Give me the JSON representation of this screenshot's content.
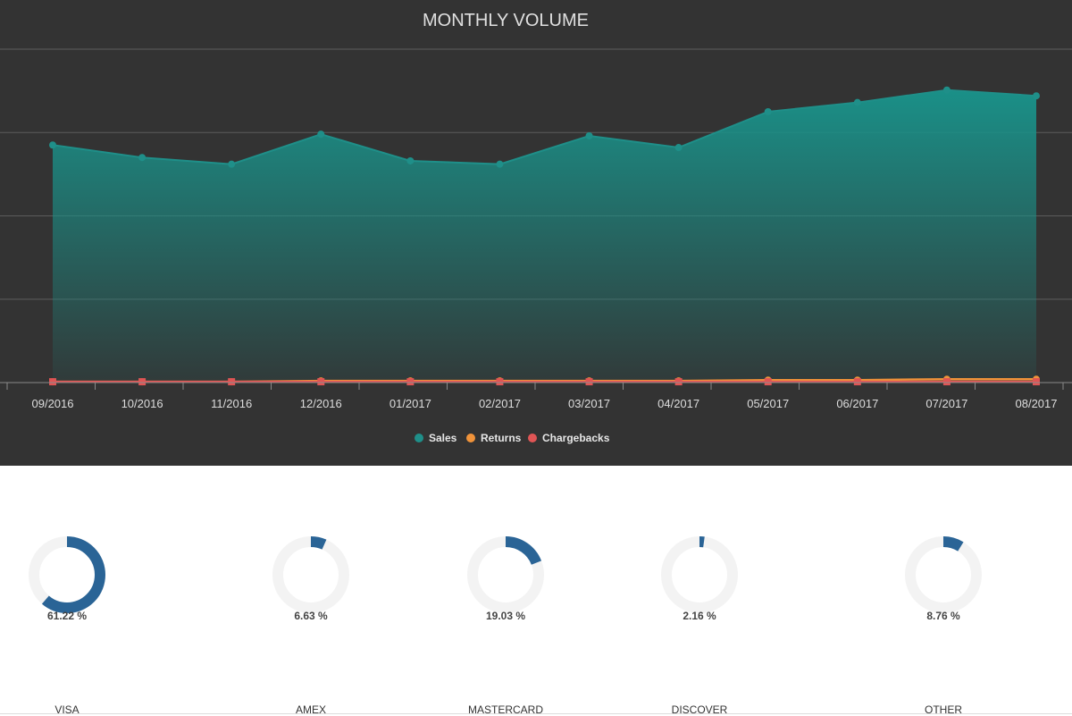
{
  "chart_data": {
    "type": "area",
    "title": "MONTHLY VOLUME",
    "categories": [
      "09/2016",
      "10/2016",
      "11/2016",
      "12/2016",
      "01/2017",
      "02/2017",
      "03/2017",
      "04/2017",
      "05/2017",
      "06/2017",
      "07/2017",
      "08/2017"
    ],
    "series": [
      {
        "name": "Sales",
        "color": "#1f8f89",
        "values": [
          285,
          270,
          262,
          298,
          266,
          262,
          296,
          282,
          325,
          336,
          351,
          344
        ]
      },
      {
        "name": "Returns",
        "color": "#f0933a",
        "values": [
          1,
          1,
          1,
          2,
          2,
          2,
          2,
          2,
          3,
          3,
          4,
          4
        ]
      },
      {
        "name": "Chargebacks",
        "color": "#e05555",
        "values": [
          1,
          1,
          1,
          1,
          1,
          1,
          1,
          1,
          1,
          1,
          1,
          1
        ]
      }
    ],
    "ylim": [
      0,
      400
    ],
    "grid": true,
    "legend": "bottom-center"
  },
  "cards": [
    {
      "brand": "VISA",
      "value": 61.22,
      "label": "61.22 %"
    },
    {
      "brand": "AMEX",
      "value": 6.63,
      "label": "6.63 %"
    },
    {
      "brand": "MASTERCARD",
      "value": 19.03,
      "label": "19.03 %"
    },
    {
      "brand": "DISCOVER",
      "value": 2.16,
      "label": "2.16 %"
    },
    {
      "brand": "OTHER",
      "value": 8.76,
      "label": "8.76 %"
    }
  ],
  "colors": {
    "ring_fill": "#2a6496",
    "ring_track": "#f3f3f3"
  }
}
